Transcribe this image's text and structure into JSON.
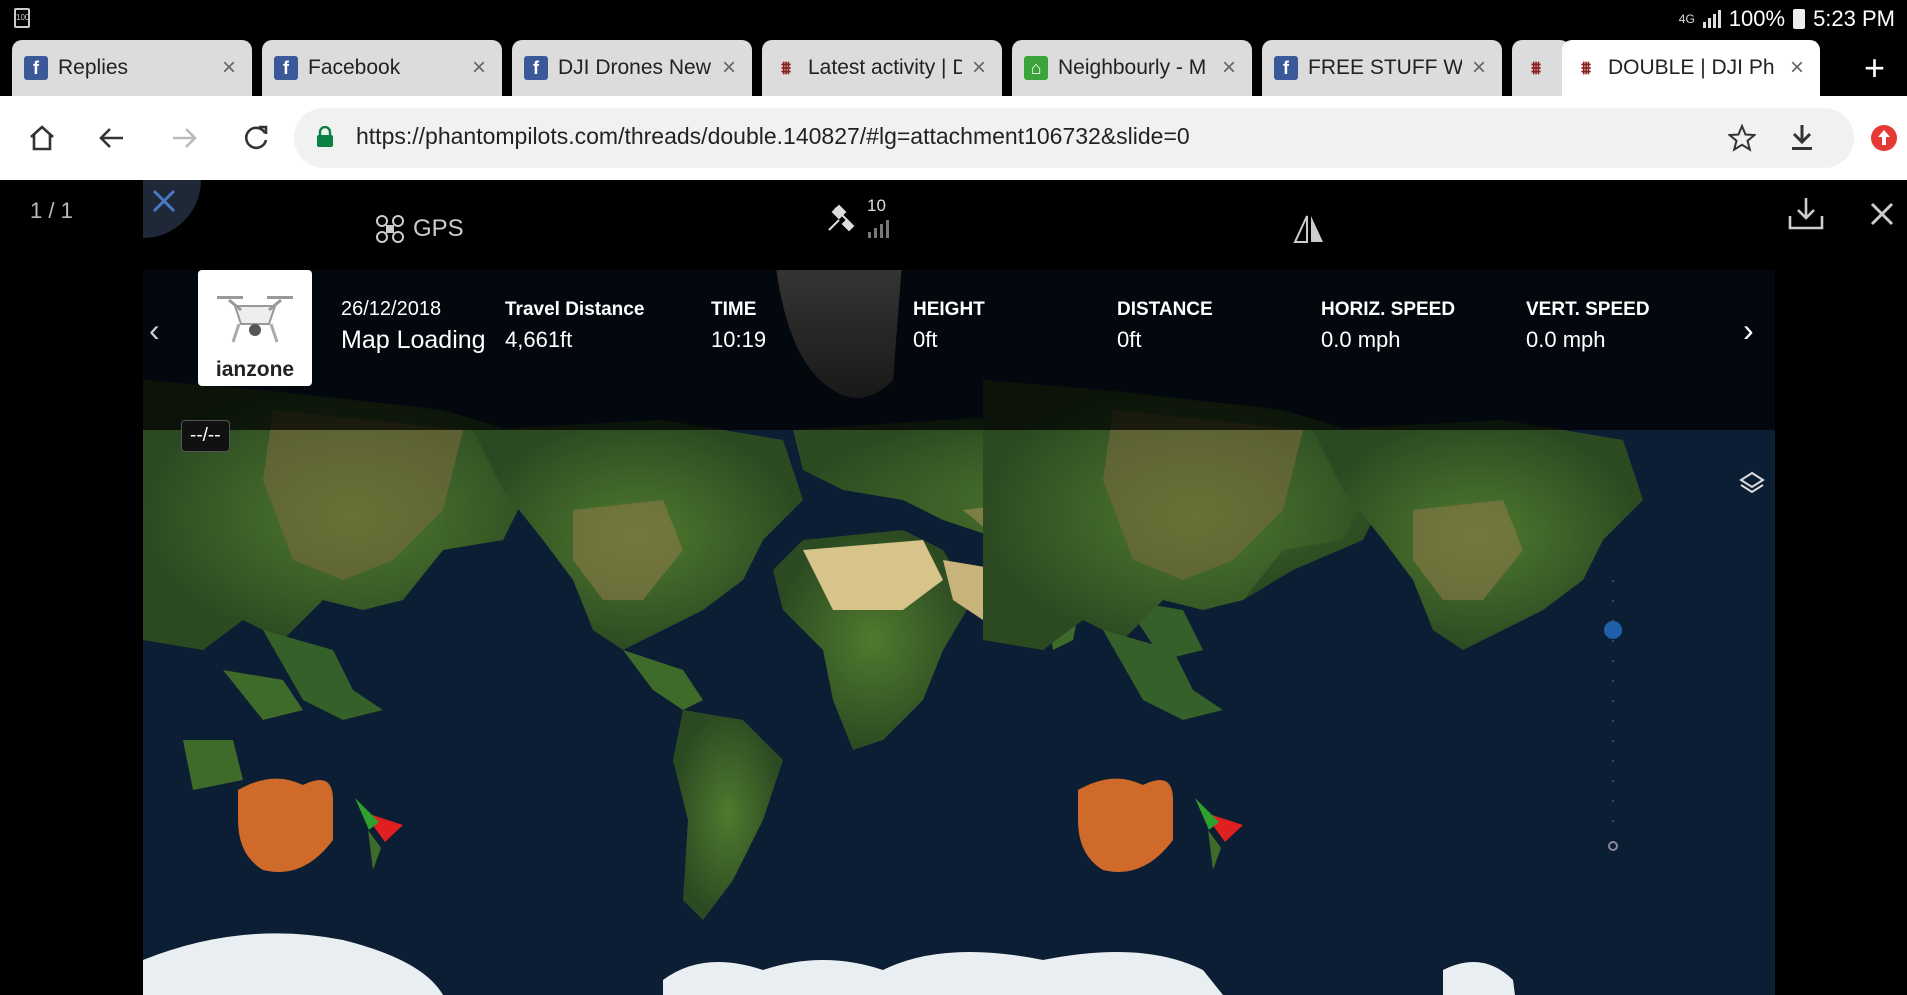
{
  "status_bar": {
    "left_icon_text": "100",
    "network": "4G",
    "battery": "100%",
    "time": "5:23 PM"
  },
  "tabs": [
    {
      "title": "Replies",
      "favicon": "facebook-icon"
    },
    {
      "title": "Facebook",
      "favicon": "facebook-icon"
    },
    {
      "title": "DJI Drones New",
      "favicon": "facebook-icon"
    },
    {
      "title": "Latest activity | D",
      "favicon": "phantompilots-icon"
    },
    {
      "title": "Neighbourly - M",
      "favicon": "neighbourly-icon"
    },
    {
      "title": "FREE STUFF WE",
      "favicon": "facebook-icon"
    },
    {
      "title": "",
      "favicon": "phantompilots-icon"
    },
    {
      "title": "DOUBLE | DJI Ph",
      "favicon": "phantompilots-icon",
      "active": true
    }
  ],
  "toolbar": {
    "url": "https://phantompilots.com/threads/double.140827/#lg=attachment106732&slide=0"
  },
  "viewer": {
    "counter": "1 / 1"
  },
  "screenshot": {
    "gps_label": "GPS",
    "satellite_count": "10",
    "pilot_name": "ianzone",
    "date": "26/12/2018",
    "map_status": "Map Loading",
    "time_tip": "--/--",
    "stats": [
      {
        "label": "Travel Distance",
        "value": "4,661ft"
      },
      {
        "label": "TIME",
        "value": "10:19"
      },
      {
        "label": "HEIGHT",
        "value": "0ft"
      },
      {
        "label": "DISTANCE",
        "value": "0ft"
      },
      {
        "label": "HORIZ. SPEED",
        "value": "0.0 mph"
      },
      {
        "label": "VERT. SPEED",
        "value": "0.0 mph"
      }
    ]
  },
  "colors": {
    "ocean": "#0c1e33",
    "land": "#3f6b2a",
    "desert": "#d7c48a",
    "australia": "#d06a2a",
    "ice": "#e9eef2",
    "marker": "#e02020",
    "facebook": "#3b5998"
  }
}
